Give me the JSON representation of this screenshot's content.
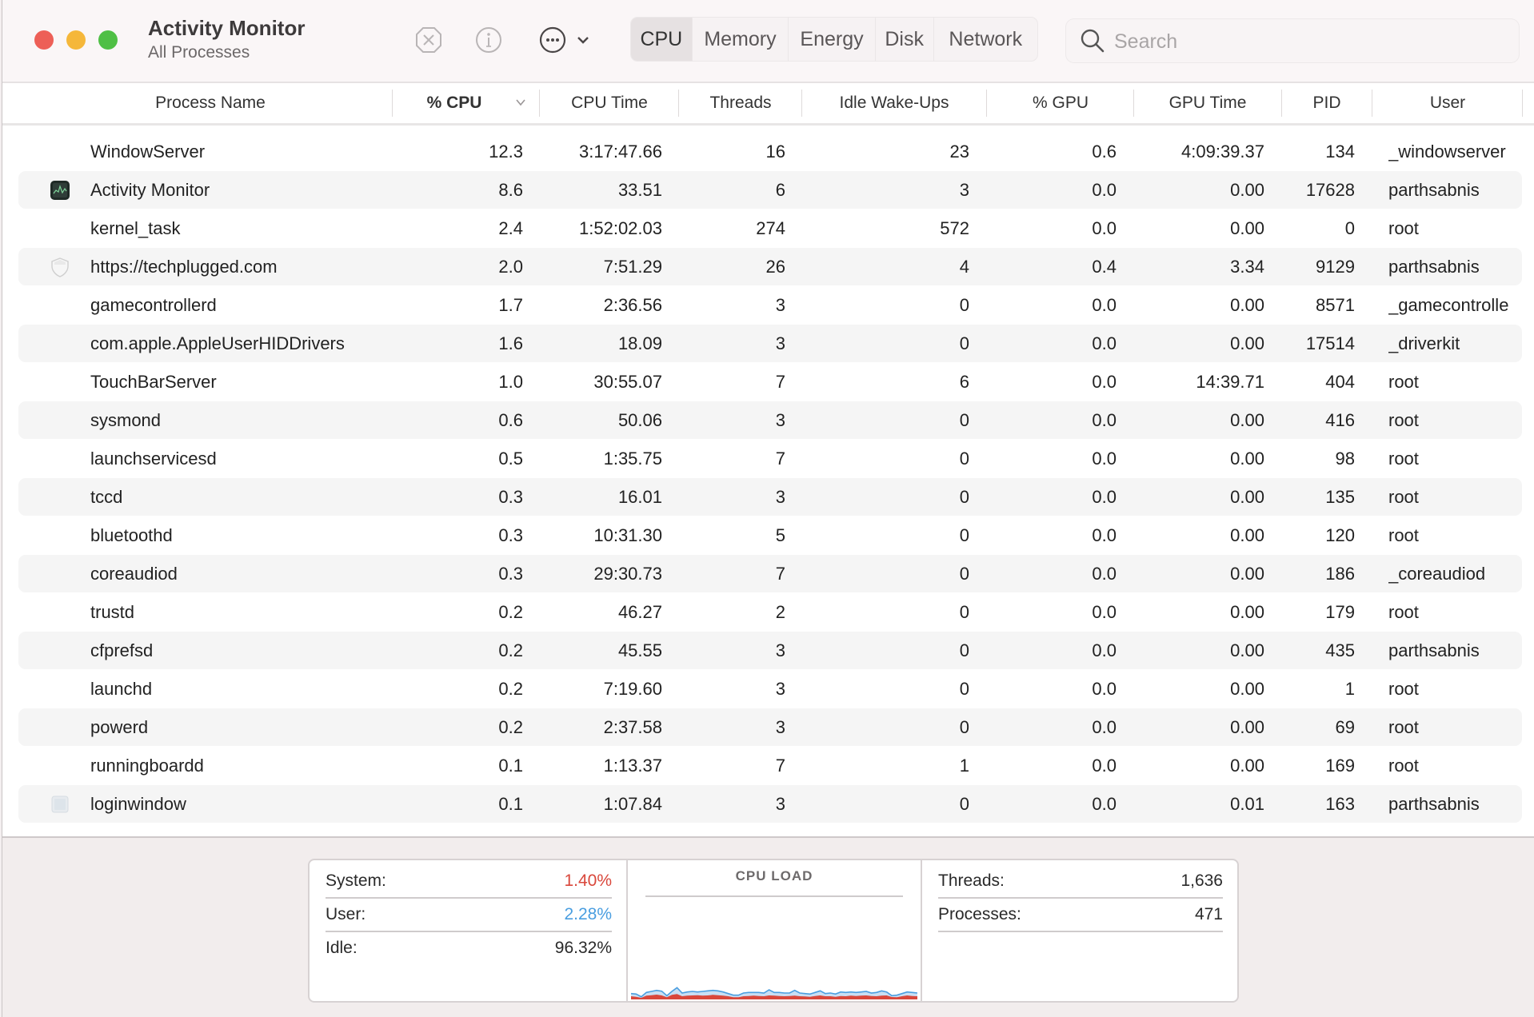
{
  "window": {
    "title": "Activity Monitor",
    "subtitle": "All Processes"
  },
  "toolbar": {
    "stop_icon": "stop-process-icon",
    "info_icon": "info-icon",
    "more_icon": "more-actions-icon",
    "tabs": [
      {
        "label": "CPU",
        "active": true
      },
      {
        "label": "Memory",
        "active": false
      },
      {
        "label": "Energy",
        "active": false
      },
      {
        "label": "Disk",
        "active": false
      },
      {
        "label": "Network",
        "active": false
      }
    ],
    "search_placeholder": "Search"
  },
  "table": {
    "columns": [
      "Process Name",
      "% CPU",
      "CPU Time",
      "Threads",
      "Idle Wake-Ups",
      "% GPU",
      "GPU Time",
      "PID",
      "User"
    ],
    "sort_column": "% CPU",
    "sort_direction": "descending",
    "rows": [
      {
        "name": "WindowServer",
        "icon": "",
        "cpu": "12.3",
        "cpu_time": "3:17:47.66",
        "threads": "16",
        "idle_wakeups": "23",
        "gpu": "0.6",
        "gpu_time": "4:09:39.37",
        "pid": "134",
        "user": "_windowserver"
      },
      {
        "name": "Activity Monitor",
        "icon": "activity-monitor-app-icon",
        "cpu": "8.6",
        "cpu_time": "33.51",
        "threads": "6",
        "idle_wakeups": "3",
        "gpu": "0.0",
        "gpu_time": "0.00",
        "pid": "17628",
        "user": "parthsabnis"
      },
      {
        "name": "kernel_task",
        "icon": "",
        "cpu": "2.4",
        "cpu_time": "1:52:02.03",
        "threads": "274",
        "idle_wakeups": "572",
        "gpu": "0.0",
        "gpu_time": "0.00",
        "pid": "0",
        "user": "root"
      },
      {
        "name": "https://techplugged.com",
        "icon": "web-shield-icon",
        "cpu": "2.0",
        "cpu_time": "7:51.29",
        "threads": "26",
        "idle_wakeups": "4",
        "gpu": "0.4",
        "gpu_time": "3.34",
        "pid": "9129",
        "user": "parthsabnis"
      },
      {
        "name": "gamecontrollerd",
        "icon": "",
        "cpu": "1.7",
        "cpu_time": "2:36.56",
        "threads": "3",
        "idle_wakeups": "0",
        "gpu": "0.0",
        "gpu_time": "0.00",
        "pid": "8571",
        "user": "_gamecontrolle"
      },
      {
        "name": "com.apple.AppleUserHIDDrivers",
        "icon": "",
        "cpu": "1.6",
        "cpu_time": "18.09",
        "threads": "3",
        "idle_wakeups": "0",
        "gpu": "0.0",
        "gpu_time": "0.00",
        "pid": "17514",
        "user": "_driverkit"
      },
      {
        "name": "TouchBarServer",
        "icon": "",
        "cpu": "1.0",
        "cpu_time": "30:55.07",
        "threads": "7",
        "idle_wakeups": "6",
        "gpu": "0.0",
        "gpu_time": "14:39.71",
        "pid": "404",
        "user": "root"
      },
      {
        "name": "sysmond",
        "icon": "",
        "cpu": "0.6",
        "cpu_time": "50.06",
        "threads": "3",
        "idle_wakeups": "0",
        "gpu": "0.0",
        "gpu_time": "0.00",
        "pid": "416",
        "user": "root"
      },
      {
        "name": "launchservicesd",
        "icon": "",
        "cpu": "0.5",
        "cpu_time": "1:35.75",
        "threads": "7",
        "idle_wakeups": "0",
        "gpu": "0.0",
        "gpu_time": "0.00",
        "pid": "98",
        "user": "root"
      },
      {
        "name": "tccd",
        "icon": "",
        "cpu": "0.3",
        "cpu_time": "16.01",
        "threads": "3",
        "idle_wakeups": "0",
        "gpu": "0.0",
        "gpu_time": "0.00",
        "pid": "135",
        "user": "root"
      },
      {
        "name": "bluetoothd",
        "icon": "",
        "cpu": "0.3",
        "cpu_time": "10:31.30",
        "threads": "5",
        "idle_wakeups": "0",
        "gpu": "0.0",
        "gpu_time": "0.00",
        "pid": "120",
        "user": "root"
      },
      {
        "name": "coreaudiod",
        "icon": "",
        "cpu": "0.3",
        "cpu_time": "29:30.73",
        "threads": "7",
        "idle_wakeups": "0",
        "gpu": "0.0",
        "gpu_time": "0.00",
        "pid": "186",
        "user": "_coreaudiod"
      },
      {
        "name": "trustd",
        "icon": "",
        "cpu": "0.2",
        "cpu_time": "46.27",
        "threads": "2",
        "idle_wakeups": "0",
        "gpu": "0.0",
        "gpu_time": "0.00",
        "pid": "179",
        "user": "root"
      },
      {
        "name": "cfprefsd",
        "icon": "",
        "cpu": "0.2",
        "cpu_time": "45.55",
        "threads": "3",
        "idle_wakeups": "0",
        "gpu": "0.0",
        "gpu_time": "0.00",
        "pid": "435",
        "user": "parthsabnis"
      },
      {
        "name": "launchd",
        "icon": "",
        "cpu": "0.2",
        "cpu_time": "7:19.60",
        "threads": "3",
        "idle_wakeups": "0",
        "gpu": "0.0",
        "gpu_time": "0.00",
        "pid": "1",
        "user": "root"
      },
      {
        "name": "powerd",
        "icon": "",
        "cpu": "0.2",
        "cpu_time": "2:37.58",
        "threads": "3",
        "idle_wakeups": "0",
        "gpu": "0.0",
        "gpu_time": "0.00",
        "pid": "69",
        "user": "root"
      },
      {
        "name": "runningboardd",
        "icon": "",
        "cpu": "0.1",
        "cpu_time": "1:13.37",
        "threads": "7",
        "idle_wakeups": "1",
        "gpu": "0.0",
        "gpu_time": "0.00",
        "pid": "169",
        "user": "root"
      },
      {
        "name": "loginwindow",
        "icon": "loginwindow-app-icon",
        "cpu": "0.1",
        "cpu_time": "1:07.84",
        "threads": "3",
        "idle_wakeups": "0",
        "gpu": "0.0",
        "gpu_time": "0.01",
        "pid": "163",
        "user": "parthsabnis"
      }
    ]
  },
  "summary": {
    "system_label": "System:",
    "system_value": "1.40%",
    "user_label": "User:",
    "user_value": "2.28%",
    "idle_label": "Idle:",
    "idle_value": "96.32%",
    "cpu_load_title": "CPU LOAD",
    "threads_label": "Threads:",
    "threads_value": "1,636",
    "processes_label": "Processes:",
    "processes_value": "471",
    "colors": {
      "system": "#d9473b",
      "user": "#4a9ee0"
    },
    "cpu_load_history": {
      "system_pct": [
        1.2,
        1.0,
        0.6,
        1.4,
        1.6,
        1.8,
        1.5,
        0.8,
        1.7,
        2.0,
        1.2,
        1.4,
        1.5,
        1.6,
        1.4,
        1.5,
        1.7,
        1.6,
        1.4,
        1.2,
        0.8,
        0.8,
        1.2,
        1.3,
        1.4,
        1.3,
        1.2,
        1.5,
        1.4,
        1.3,
        1.2,
        1.3,
        1.4,
        1.2,
        1.1,
        1.0,
        1.3,
        1.5,
        1.2,
        1.2,
        1.0,
        1.3,
        1.2,
        1.4,
        1.3,
        1.4,
        1.5,
        1.3,
        1.2,
        1.4,
        1.5,
        0.9,
        0.8,
        1.2,
        1.5,
        1.3,
        1.2
      ],
      "user_pct": [
        2.2,
        2.0,
        1.0,
        2.6,
        3.0,
        3.4,
        3.1,
        1.4,
        3.0,
        4.4,
        2.4,
        2.8,
        3.0,
        2.8,
        3.0,
        3.2,
        3.4,
        3.2,
        2.8,
        2.2,
        1.6,
        1.6,
        2.4,
        2.6,
        2.6,
        2.6,
        2.4,
        3.6,
        2.6,
        2.6,
        2.4,
        2.4,
        3.4,
        2.4,
        2.2,
        2.0,
        2.6,
        3.2,
        2.2,
        2.4,
        2.0,
        2.8,
        2.6,
        2.8,
        2.6,
        2.8,
        3.0,
        2.4,
        2.6,
        3.2,
        2.8,
        1.4,
        1.6,
        2.2,
        2.8,
        2.6,
        2.4
      ]
    }
  }
}
